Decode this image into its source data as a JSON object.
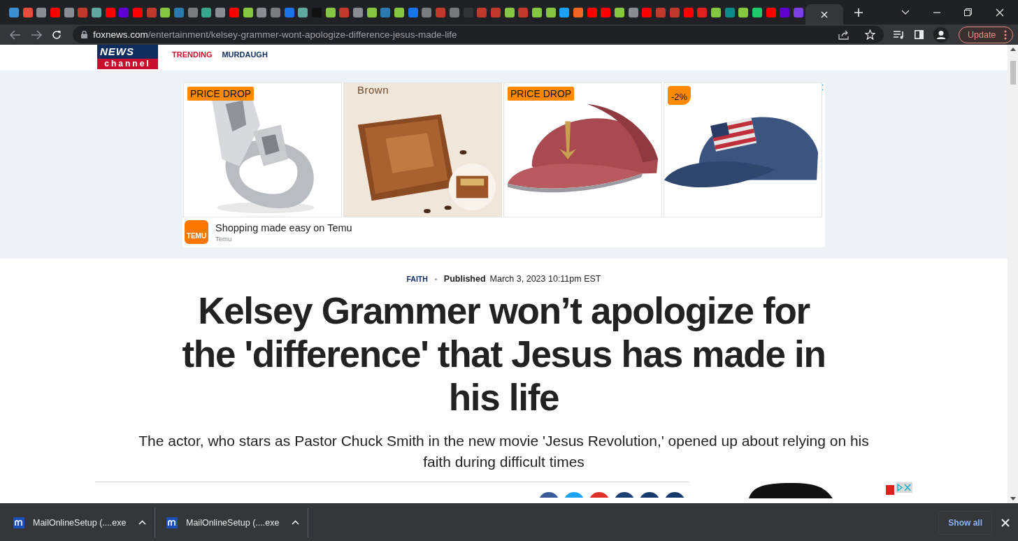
{
  "browser": {
    "tabs": [
      {
        "color": "#3b8fd0",
        "selected": false
      },
      {
        "color": "#e94b3c",
        "selected": false
      },
      {
        "color": "#8a8d91",
        "selected": false
      },
      {
        "color": "#ff0000",
        "selected": false
      },
      {
        "color": "#8a8d91",
        "selected": false
      },
      {
        "color": "#c0392b",
        "selected": false
      },
      {
        "color": "#5fa8a0",
        "selected": false
      },
      {
        "color": "#ff0000",
        "selected": false
      },
      {
        "color": "#6001d2",
        "selected": false
      },
      {
        "color": "#ff0000",
        "selected": false
      },
      {
        "color": "#c0392b",
        "selected": false
      },
      {
        "color": "#85c742",
        "selected": false
      },
      {
        "color": "#2a7ab0",
        "selected": false
      },
      {
        "color": "#7a7d80",
        "selected": false
      },
      {
        "color": "#3aa58a",
        "selected": false
      },
      {
        "color": "#8a8d91",
        "selected": false
      },
      {
        "color": "#ff0000",
        "selected": false
      },
      {
        "color": "#85c742",
        "selected": false
      },
      {
        "color": "#8a8d91",
        "selected": false
      },
      {
        "color": "#7a7d80",
        "selected": false
      },
      {
        "color": "#1a73e8",
        "selected": false
      },
      {
        "color": "#5fa8a0",
        "selected": false
      },
      {
        "color": "#111111",
        "selected": false
      },
      {
        "color": "#85c742",
        "selected": false
      },
      {
        "color": "#c0392b",
        "selected": false
      },
      {
        "color": "#8a8d91",
        "selected": false
      },
      {
        "color": "#85c742",
        "selected": false
      },
      {
        "color": "#2a7ab0",
        "selected": false
      },
      {
        "color": "#85c742",
        "selected": false
      },
      {
        "color": "#1a73e8",
        "selected": false
      },
      {
        "color": "#7a7d80",
        "selected": false
      },
      {
        "color": "#c0392b",
        "selected": false
      },
      {
        "color": "#77787a",
        "selected": false
      },
      {
        "color": "#333438",
        "selected": false
      },
      {
        "color": "#c0392b",
        "selected": false
      },
      {
        "color": "#c0392b",
        "selected": false
      },
      {
        "color": "#85c742",
        "selected": false
      },
      {
        "color": "#c0392b",
        "selected": false
      },
      {
        "color": "#85c742",
        "selected": false
      },
      {
        "color": "#85c742",
        "selected": false
      },
      {
        "color": "#1da1f2",
        "selected": false
      },
      {
        "color": "#f26522",
        "selected": false
      },
      {
        "color": "#ff0000",
        "selected": false
      },
      {
        "color": "#ff0000",
        "selected": false
      },
      {
        "color": "#85c742",
        "selected": false
      },
      {
        "color": "#8a8d91",
        "selected": false
      },
      {
        "color": "#ff0000",
        "selected": false
      },
      {
        "color": "#c0392b",
        "selected": false
      },
      {
        "color": "#c0392b",
        "selected": false
      },
      {
        "color": "#ff0000",
        "selected": false
      },
      {
        "color": "#e0201b",
        "selected": false
      },
      {
        "color": "#85c742",
        "selected": false
      },
      {
        "color": "#0c8a8a",
        "selected": false
      },
      {
        "color": "#85c742",
        "selected": false
      },
      {
        "color": "#1ec96b",
        "selected": false
      },
      {
        "color": "#ff0000",
        "selected": false
      },
      {
        "color": "#6001d2",
        "selected": false
      },
      {
        "color": "#7b3fe4",
        "selected": false
      },
      {
        "selected": true
      }
    ],
    "address": {
      "domain": "foxnews.com",
      "path": "/entertainment/kelsey-grammer-wont-apologize-difference-jesus-made-life"
    },
    "update_button": "Update"
  },
  "site_header": {
    "logo": {
      "top": "NEWS",
      "bottom": "channel"
    },
    "nav": [
      {
        "label": "TRENDING",
        "kind": "highlight"
      },
      {
        "label": "MURDAUGH",
        "kind": "plain"
      }
    ]
  },
  "ad": {
    "products": [
      {
        "kind": "ring",
        "badge": {
          "text": "PRICE DROP",
          "kind": "banner"
        }
      },
      {
        "kind": "wallet",
        "label": "Brown"
      },
      {
        "kind": "red-cap",
        "badge": {
          "text": "PRICE DROP",
          "kind": "banner"
        }
      },
      {
        "kind": "blue-cap",
        "badge": {
          "text": "-2%",
          "kind": "tag"
        }
      }
    ],
    "logo": "TEMU",
    "headline": "Shopping made easy on Temu",
    "advertiser": "Temu"
  },
  "article": {
    "category": "FAITH",
    "published_label": "Published",
    "published_date": "March 3, 2023 10:11pm EST",
    "headline": "Kelsey Grammer won’t apologize for the 'difference' that Jesus has made in his life",
    "subheadline": "The actor, who stars as Pastor Chuck Smith in the new movie 'Jesus Revolution,' opened up about relying on his faith during difficult times",
    "share_buttons": [
      {
        "color": "#3b5998"
      },
      {
        "color": "#1da1f2"
      },
      {
        "color": "#e0302a"
      },
      {
        "color": "#1b3f70"
      },
      {
        "color": "#163a6b"
      },
      {
        "color": "#163a6b"
      }
    ]
  },
  "downloads": {
    "items": [
      {
        "name": "MailOnlineSetup (....exe"
      },
      {
        "name": "MailOnlineSetup (....exe"
      }
    ],
    "show_all": "Show all"
  }
}
